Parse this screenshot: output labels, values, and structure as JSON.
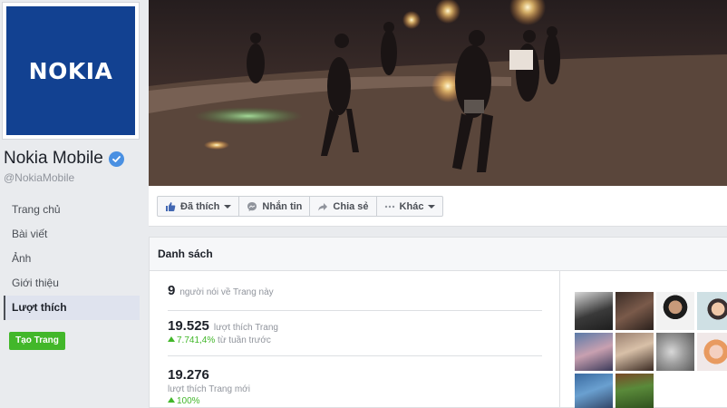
{
  "page": {
    "logo_text": "NOKIA",
    "name": "Nokia Mobile",
    "handle": "@NokiaMobile"
  },
  "nav": {
    "items": [
      {
        "label": "Trang chủ"
      },
      {
        "label": "Bài viết"
      },
      {
        "label": "Ảnh"
      },
      {
        "label": "Giới thiệu"
      },
      {
        "label": "Lượt thích",
        "active": true
      }
    ],
    "create_button": "Tạo Trang"
  },
  "actions": {
    "liked": "Đã thích",
    "message": "Nhắn tin",
    "share": "Chia sẻ",
    "more": "Khác"
  },
  "panel": {
    "title": "Danh sách",
    "talking_count": "9",
    "talking_label": "người nói về Trang này",
    "total_likes": "19.525",
    "total_likes_label": "lượt thích Trang",
    "growth_pct": "7.741,4%",
    "growth_label": "từ tuần trước",
    "new_likes": "19.276",
    "new_likes_label": "lượt thích Trang mới",
    "new_likes_pct": "100%"
  },
  "colors": {
    "nokia_blue": "#124191",
    "verified": "#4a90e2",
    "create_green": "#42b72a",
    "growth_green": "#42b72a"
  },
  "thumbnails": [
    "person-1",
    "person-2",
    "person-3",
    "person-4",
    "person-5",
    "person-6",
    "person-7",
    "person-8",
    "phone",
    "forest"
  ]
}
